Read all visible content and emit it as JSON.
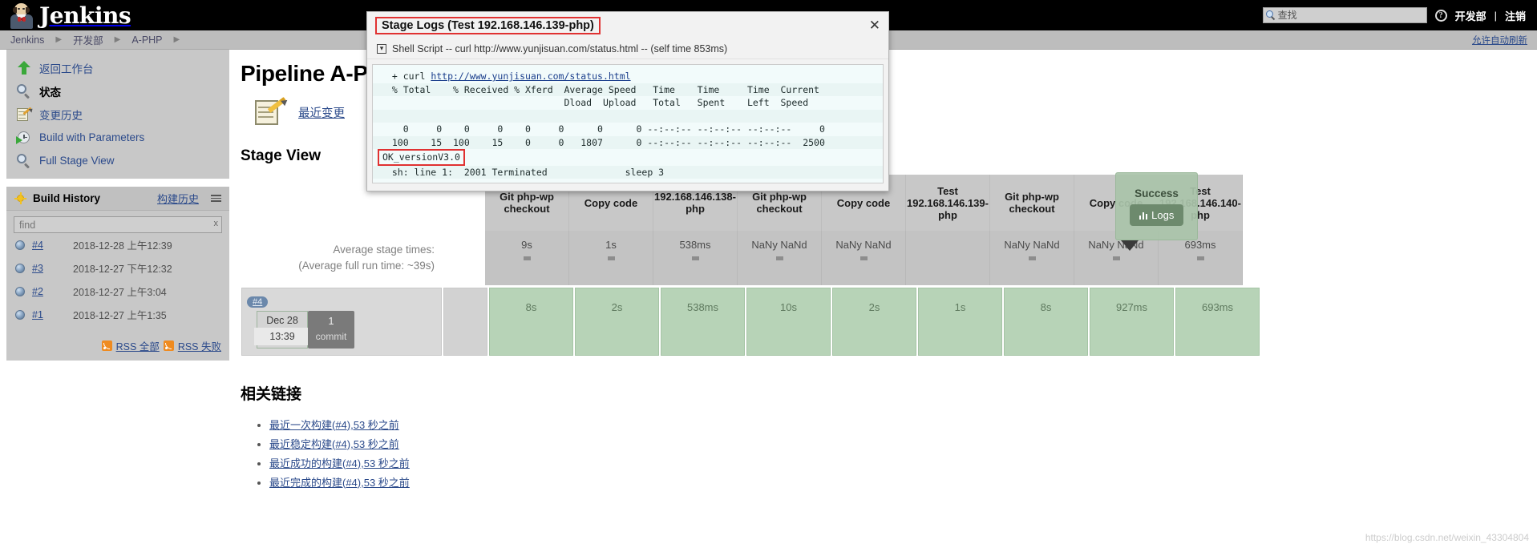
{
  "header": {
    "logo_text": "Jenkins",
    "search_placeholder": "查找",
    "help_label": "?",
    "user": "开发部",
    "separator": "|",
    "logout": "注销"
  },
  "breadcrumb": {
    "items": [
      "Jenkins",
      "开发部",
      "A-PHP"
    ],
    "autorefresh": "允许自动刷新"
  },
  "sidebar": {
    "tasks": [
      {
        "label": "返回工作台",
        "icon": "up-arrow-icon"
      },
      {
        "label": "状态",
        "icon": "magnifier-icon"
      },
      {
        "label": "变更历史",
        "icon": "notepad-pencil-icon"
      },
      {
        "label": "Build with Parameters",
        "icon": "clock-play-icon"
      },
      {
        "label": "Full Stage View",
        "icon": "magnifier-icon"
      }
    ],
    "build_history": {
      "title": "Build History",
      "link": "构建历史",
      "find_placeholder": "find",
      "find_value": "",
      "clear_label": "x",
      "builds": [
        {
          "number": "#4",
          "date": "2018-12-28 上午12:39"
        },
        {
          "number": "#3",
          "date": "2018-12-27 下午12:32"
        },
        {
          "number": "#2",
          "date": "2018-12-27 上午3:04"
        },
        {
          "number": "#1",
          "date": "2018-12-27 上午1:35"
        }
      ],
      "rss_all": "RSS 全部",
      "rss_failed": "RSS 失败"
    }
  },
  "main": {
    "pipeline_title": "Pipeline A-PHP",
    "changes_link": "最近变更",
    "stage_view_heading": "Stage View",
    "average_label_line1": "Average stage times:",
    "average_label_line2": "(Average full run time: ~39s)",
    "stages": [
      "Git php-wp checkout",
      "Copy code",
      "192.168.146.138-php",
      "Git php-wp checkout",
      "Copy code",
      "Test 192.168.146.139-php",
      "Git php-wp checkout",
      "Copy code",
      "Test 192.168.146.140-php"
    ],
    "average_times": [
      "9s",
      "1s",
      "538ms",
      "NaNy NaNd",
      "NaNy NaNd",
      "",
      "NaNy NaNd",
      "NaNy NaNd",
      "693ms"
    ],
    "run": {
      "badge": "#4",
      "date": "Dec 28",
      "time": "13:39",
      "commit_count": "1",
      "commit_label": "commit",
      "times": [
        "8s",
        "2s",
        "538ms",
        "10s",
        "2s",
        "1s",
        "8s",
        "927ms",
        "693ms"
      ]
    },
    "success_popup": {
      "status": "Success",
      "logs_button": "Logs"
    },
    "related": {
      "title": "相关链接",
      "links": [
        "最近一次构建(#4),53 秒之前",
        "最近稳定构建(#4),53 秒之前",
        "最近成功的构建(#4),53 秒之前",
        "最近完成的构建(#4),53 秒之前"
      ]
    }
  },
  "modal": {
    "title": "Stage Logs (Test 192.168.146.139-php)",
    "close_label": "✕",
    "subhead": "Shell Script -- curl http://www.yunjisuan.com/status.html -- (self time 853ms)",
    "log_lines": [
      "  + curl ",
      "  % Total    % Received % Xferd  Average Speed   Time    Time     Time  Current",
      "                                 Dload  Upload   Total   Spent    Left  Speed",
      "",
      "    0     0    0     0    0     0      0      0 --:--:-- --:--:-- --:--:--     0",
      "  100    15  100    15    0     0   1807      0 --:--:-- --:--:-- --:--:--  2500",
      "OK_versionV3.0",
      "  sh: line 1:  2001 Terminated              sleep 3"
    ],
    "curl_url": "http://www.yunjisuan.com/status.html",
    "highlight_line": "OK_versionV3.0"
  },
  "watermark": "https://blog.csdn.net/weixin_43304804",
  "colors": {
    "accent_link": "#2b4a8b",
    "success_green": "#b7d3b7",
    "highlight_red": "#e03131",
    "header_black": "#000000"
  }
}
